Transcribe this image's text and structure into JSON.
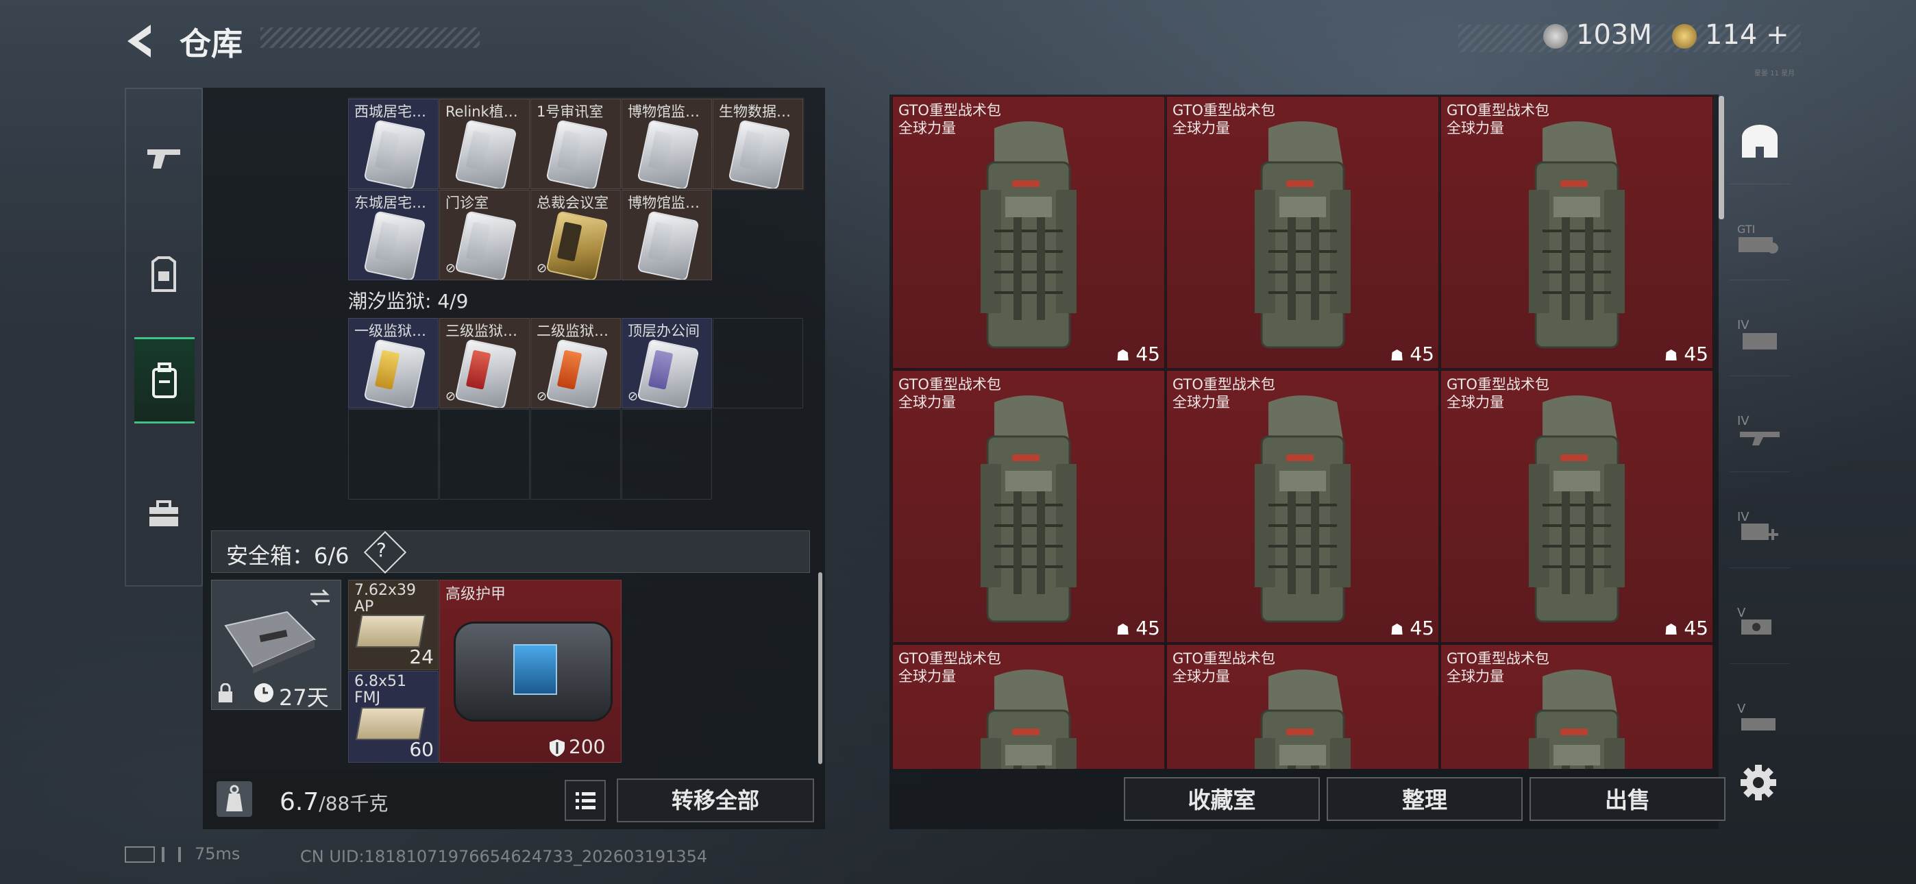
{
  "header": {
    "title": "仓库",
    "currency_1": "103M",
    "currency_2": "114",
    "currency_2_add": "+",
    "version": "星晏 11 星月"
  },
  "left_nav": [
    {
      "name": "weapon-tab-icon"
    },
    {
      "name": "armor-tab-icon"
    },
    {
      "name": "backpack-tab-icon",
      "active": true
    },
    {
      "name": "briefcase-tab-icon"
    }
  ],
  "keycards_row1": [
    "西城居宅…",
    "Relink植…",
    "1号审讯室",
    "博物馆监…",
    "生物数据…"
  ],
  "keycards_row2": [
    "东城居宅…",
    "门诊室",
    "总裁会议室",
    "博物馆监…"
  ],
  "prison": {
    "title": "潮汐监狱: 4/9",
    "cards": [
      "一级监狱…",
      "三级监狱…",
      "二级监狱…",
      "顶层办公间"
    ]
  },
  "safe": {
    "label": "安全箱：6/6",
    "help": "?",
    "days": "27天"
  },
  "safe_items": {
    "ammo1": {
      "name": "7.62x39",
      "sub": "AP",
      "count": "24"
    },
    "ammo2": {
      "name": "6.8x51",
      "sub": "FMJ",
      "count": "60"
    },
    "armor": {
      "name": "高级护甲",
      "durability": "200"
    }
  },
  "footer_left": {
    "weight": "6.7",
    "weight_max": "/88千克",
    "transfer": "转移全部"
  },
  "backpacks": {
    "name": "GTO重型战术包",
    "tag": "全球力量",
    "count": "45"
  },
  "buttons": {
    "collection": "收藏室",
    "sort": "整理",
    "sell": "出售"
  },
  "status": {
    "ping": "75ms",
    "uid": "CN UID:18181071976654624733_202603191354"
  },
  "colors": {
    "accent": "#3fc28a",
    "item_bg": "#6a1e22"
  }
}
